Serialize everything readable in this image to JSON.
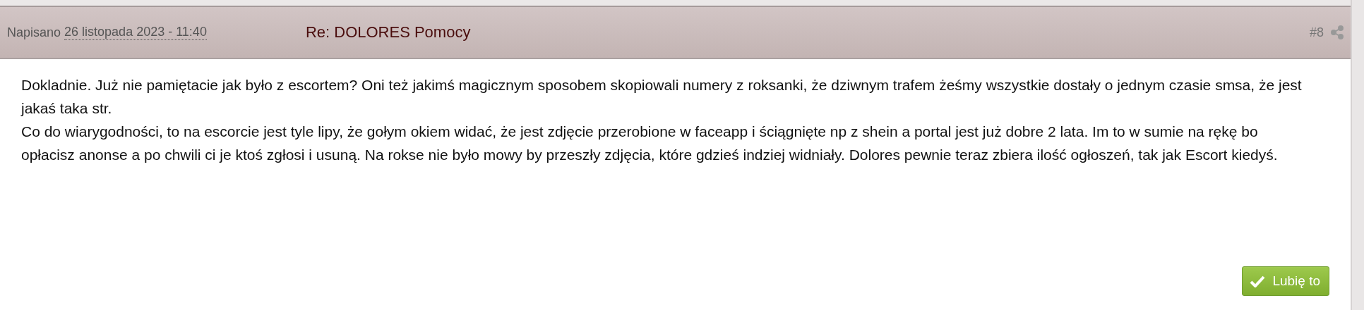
{
  "post": {
    "posted_label": "Napisano",
    "date": "26 listopada 2023 - 11:40",
    "title": "Re: DOLORES Pomocy",
    "number": "#8",
    "paragraphs": [
      "Dokladnie. Już nie pamiętacie jak było z escortem? Oni też jakimś magicznym sposobem skopiowali numery z roksanki, że dziwnym trafem żeśmy wszystkie dostały o jednym czasie smsa, że jest jakaś taka str.",
      "Co do wiarygodności, to na escorcie jest tyle lipy, że gołym okiem widać, że jest zdjęcie przerobione w faceapp i ściągnięte np z shein a portal jest już dobre 2 lata. Im to w sumie na rękę bo opłacisz anonse a po chwili ci je ktoś zgłosi i usuną. Na rokse nie było mowy by przeszły zdjęcia, które gdzieś indziej widniały. Dolores pewnie teraz zbiera ilość ogłoszeń, tak jak Escort kiedyś."
    ],
    "like_button": "Lubię to"
  }
}
